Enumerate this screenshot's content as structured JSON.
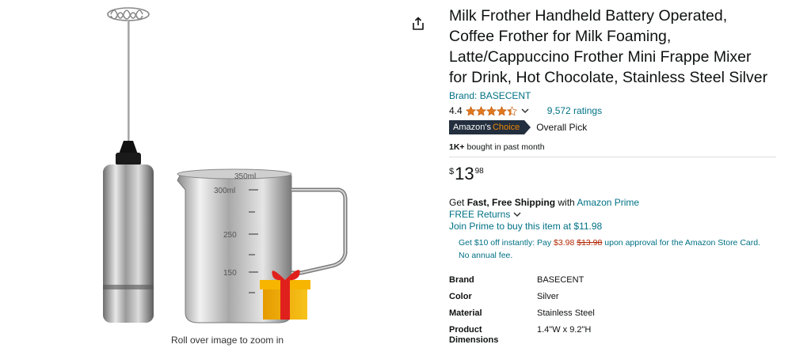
{
  "gallery": {
    "zoom_hint": "Roll over image to zoom in",
    "share_icon": "share-icon",
    "pitcher_marks": [
      "350ml",
      "300ml",
      "250",
      "150"
    ],
    "gift_icon": "gift-box-icon"
  },
  "product": {
    "title_lines": [
      "Milk Frother Handheld Battery Operated,",
      "Coffee Frother for Milk Foaming,",
      "Latte/Cappuccino Frother Mini Frappe Mixer",
      "for Drink, Hot Chocolate, Stainless Steel Silver"
    ],
    "brand_link": "Brand: BASECENT",
    "rating": "4.4",
    "rating_value": 4.4,
    "ratings_count": "9,572 ratings",
    "badge_prefix": "Amazon's",
    "badge_choice": "Choice",
    "badge_label": "Overall Pick",
    "bought_bold": "1K+",
    "bought_text": " bought in past month",
    "price": {
      "symbol": "$",
      "whole": "13",
      "fraction": "98"
    },
    "shipping": {
      "prefix": "Get ",
      "bold": "Fast, Free Shipping",
      "with": " with ",
      "prime_link": "Amazon Prime"
    },
    "returns": "FREE Returns",
    "join_prime": "Join Prime to buy this item at $11.98",
    "promo": {
      "part1": "Get $10 off instantly: Pay ",
      "new_price": "$3.98",
      "old_price": "$13.98",
      "part2": " upon approval for the Amazon Store Card.",
      "line2": "No annual fee."
    },
    "specs": [
      {
        "key": "Brand",
        "value": "BASECENT"
      },
      {
        "key": "Color",
        "value": "Silver"
      },
      {
        "key": "Material",
        "value": "Stainless Steel"
      },
      {
        "key": "Product Dimensions",
        "key_line1": "Product",
        "key_line2": "Dimensions",
        "value": "1.4\"W x 9.2\"H"
      }
    ]
  },
  "colors": {
    "link": "#007185",
    "star": "#DE7921",
    "badge_bg": "#232F3E",
    "badge_choice": "#F08804",
    "price_red": "#B12704"
  }
}
